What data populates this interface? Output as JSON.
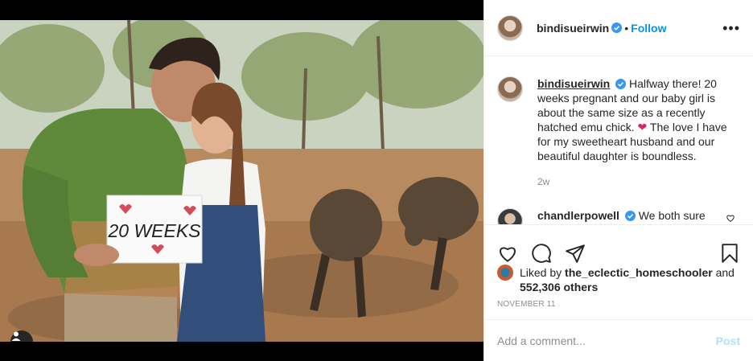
{
  "post": {
    "username": "bindisueirwin",
    "follow_label": "Follow",
    "separator": "•",
    "more_label": "•••",
    "caption": {
      "username": "bindisueirwin",
      "text_1": "Halfway there! 20 weeks pregnant and our baby girl is about the same size as a recently hatched emu chick.",
      "emoji": "❤",
      "text_2": "The love I have for my sweetheart husband and our beautiful daughter is boundless.",
      "time": "2w"
    },
    "comment": {
      "username": "chandlerpowell",
      "text": "We both sure"
    },
    "sign_text": "20 WEEKS",
    "likes": {
      "prefix": "Liked by",
      "user": "the_eclectic_homeschooler",
      "and": "and",
      "others": "552,306 others"
    },
    "date": "NOVEMBER 11",
    "add_comment_placeholder": "Add a comment...",
    "post_button": "Post"
  },
  "icons": {
    "verified": "verified-badge-icon",
    "heart": "heart-icon",
    "comment": "comment-icon",
    "share": "share-icon",
    "save": "bookmark-icon",
    "user_tag": "user-tag-icon",
    "small_heart": "small-heart-icon"
  },
  "colors": {
    "link_blue": "#0095f6",
    "post_disabled": "#b2dffc",
    "muted": "#8e8e8e",
    "text": "#262626"
  }
}
